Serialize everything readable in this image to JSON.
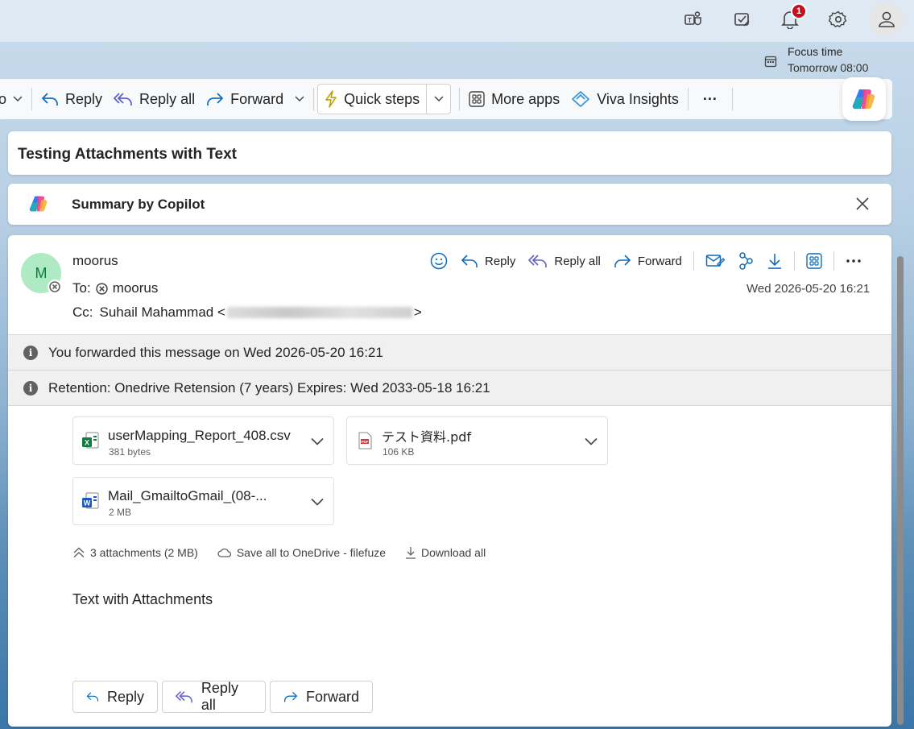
{
  "topbar": {
    "icons": [
      "teams-icon",
      "tasks-icon",
      "bell-icon",
      "settings-icon",
      "account-icon"
    ],
    "notification_count": "1"
  },
  "focus": {
    "title": "Focus time",
    "time": "Tomorrow 08:00"
  },
  "toolbar": {
    "partial_item": "o",
    "reply": "Reply",
    "reply_all": "Reply all",
    "forward": "Forward",
    "quick_steps": "Quick steps",
    "more_apps": "More apps",
    "viva_insights": "Viva Insights",
    "more": "···"
  },
  "subject": "Testing Attachments with Text",
  "summary": {
    "label": "Summary by Copilot"
  },
  "message": {
    "avatar_initial": "M",
    "sender": "moorus",
    "to_label": "To:",
    "to_value": "moorus",
    "cc_label": "Cc:",
    "cc_name": "Suhail Mahammad <",
    "cc_close": ">",
    "date": "Wed 2026-05-20 16:21",
    "actions": {
      "reply": "Reply",
      "reply_all": "Reply all",
      "forward": "Forward"
    },
    "banner_forwarded": "You forwarded this message on Wed 2026-05-20 16:21",
    "banner_retention": "Retention: Onedrive Retension (7 years) Expires: Wed 2033-05-18 16:21",
    "attachments": [
      {
        "name": "userMapping_Report_408.csv",
        "size": "381 bytes",
        "type": "excel"
      },
      {
        "name": "テスト資料.pdf",
        "size": "106 KB",
        "type": "pdf"
      },
      {
        "name": "Mail_GmailtoGmail_(08-...",
        "size": "2 MB",
        "type": "word"
      }
    ],
    "att_count": "3 attachments (2 MB)",
    "save_onedrive": "Save all to OneDrive - filefuze",
    "download_all": "Download all",
    "body": "Text with Attachments",
    "footer": {
      "reply": "Reply",
      "reply_all": "Reply all",
      "forward": "Forward"
    }
  },
  "colors": {
    "accent": "#0f6cbd",
    "badge": "#c50f1f",
    "avatar_bg": "#aeeac4"
  }
}
